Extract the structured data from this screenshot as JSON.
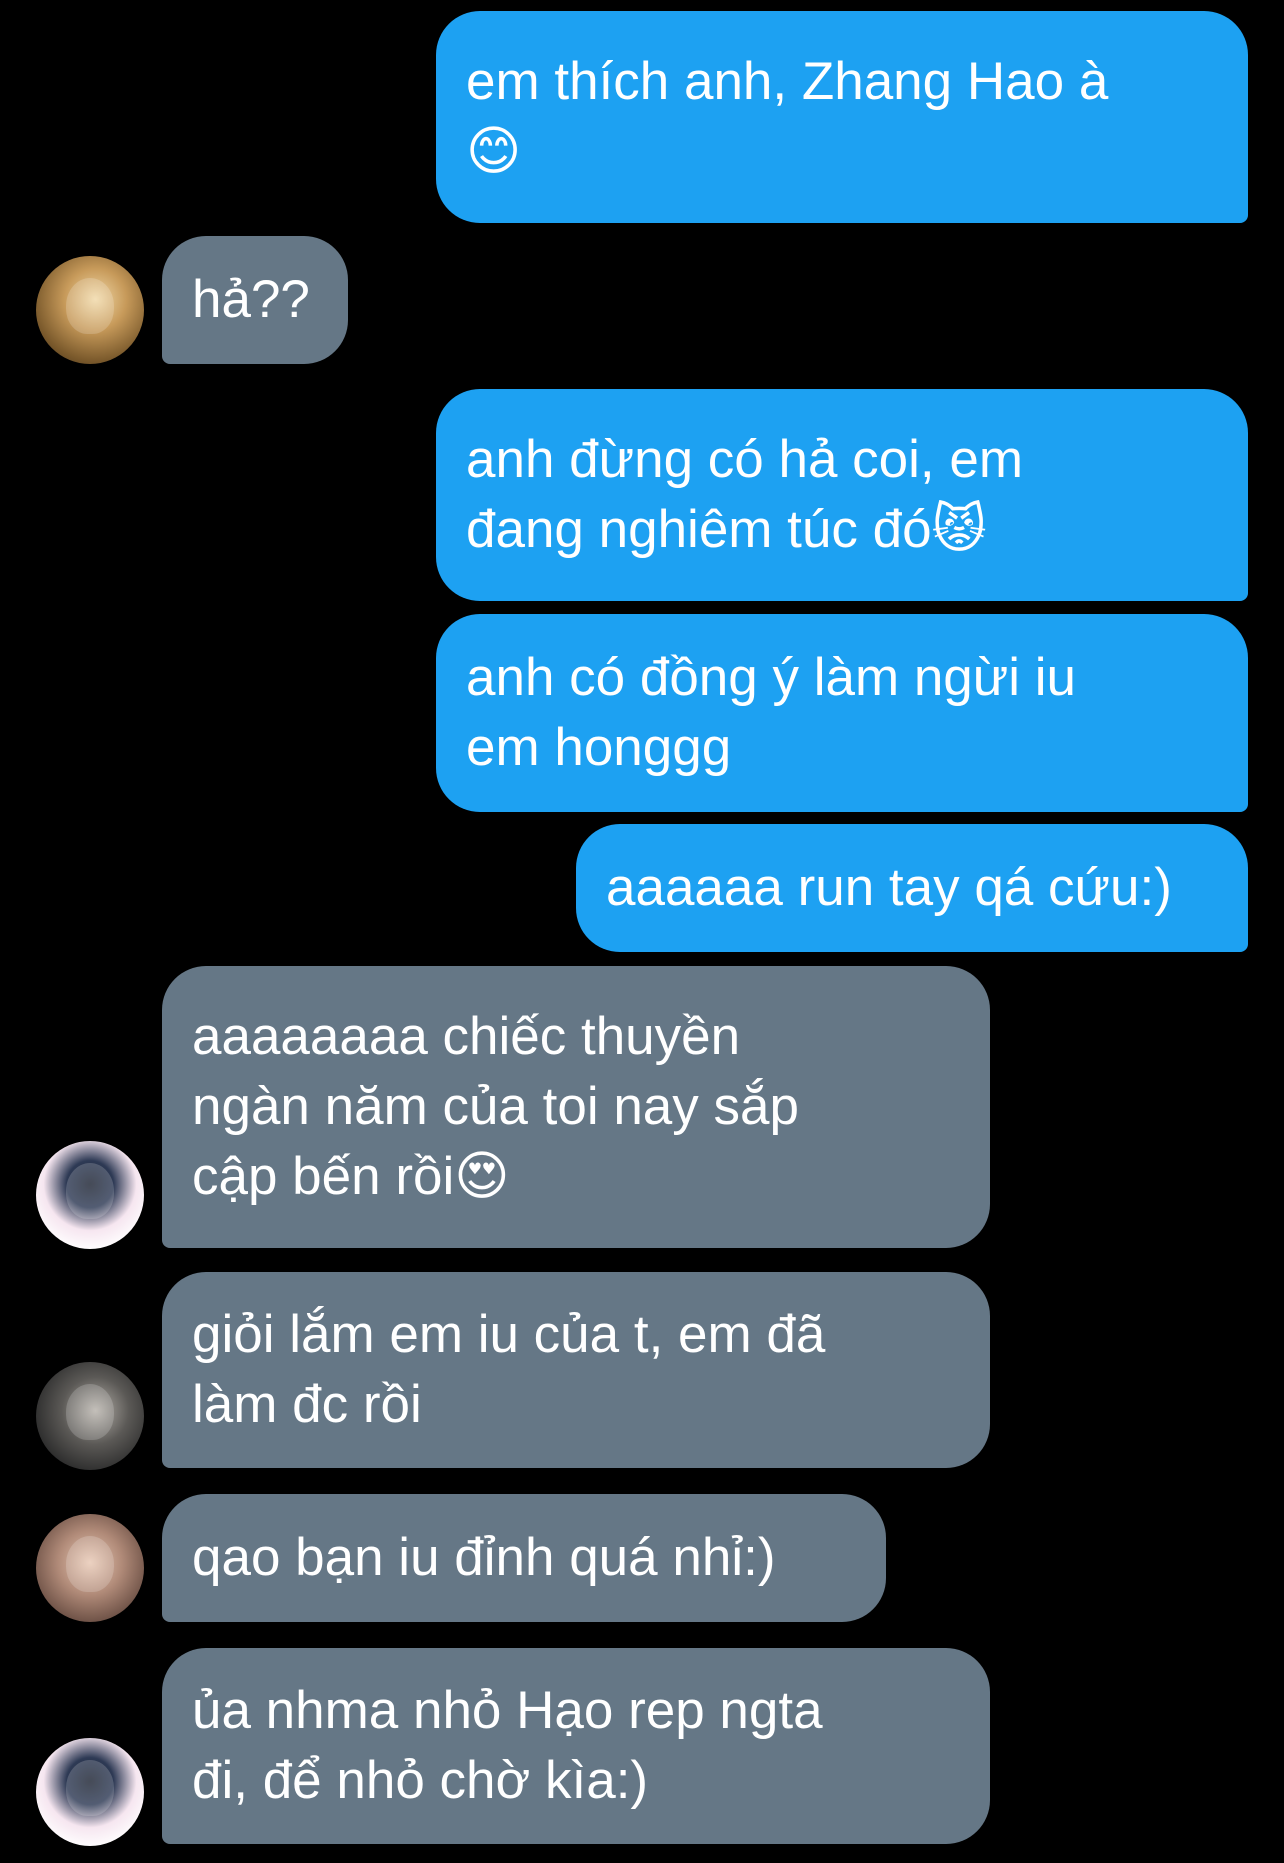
{
  "conversation": {
    "messages": [
      {
        "side": "sent",
        "text": "em thích anh, Zhang Hao à\n😊"
      },
      {
        "side": "recv",
        "text": "hả??",
        "avatar": "avatar-1"
      },
      {
        "side": "sent",
        "text": "anh đừng có hả coi, em\nđang nghiêm túc đó😾"
      },
      {
        "side": "sent",
        "text": "anh có đồng ý làm ngừi iu\nem honggg"
      },
      {
        "side": "sent",
        "text": "aaaaaa run tay qá cứu:)"
      },
      {
        "side": "recv",
        "text": "aaaaaaaa chiếc thuyền\nngàn năm của toi nay sắp\ncập bến rồi😍",
        "avatar": "avatar-2"
      },
      {
        "side": "recv",
        "text": "giỏi lắm em iu của t, em đã\nlàm đc rồi",
        "avatar": "avatar-3"
      },
      {
        "side": "recv",
        "text": "qao bạn iu đỉnh quá nhỉ:)",
        "avatar": "avatar-4"
      },
      {
        "side": "recv",
        "text": "ủa nhma nhỏ Hạo rep ngta\nđi, để nhỏ chờ kìa:)",
        "avatar": "avatar-5"
      }
    ]
  },
  "colors": {
    "background": "#000000",
    "sent_bubble": "#1DA1F2",
    "received_bubble": "#657786",
    "text": "#FFFFFF"
  }
}
